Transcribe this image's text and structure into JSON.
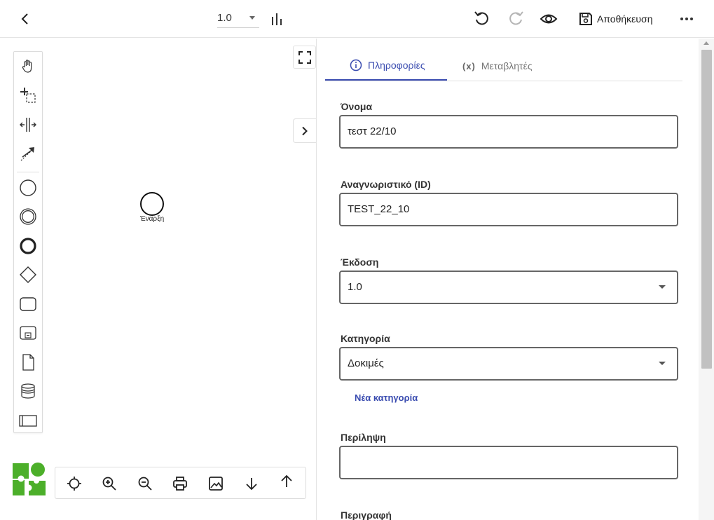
{
  "topbar": {
    "version_value": "1.0",
    "save_label": "Αποθήκευση"
  },
  "canvas": {
    "start_event_label": "Έναρξη"
  },
  "panel": {
    "tabs": [
      {
        "label": "Πληροφορίες",
        "active": true
      },
      {
        "label": "Μεταβλητές",
        "active": false
      }
    ],
    "vars_tab_icon": "(x)",
    "fields": {
      "name_label": "Όνομα",
      "name_value": "τεστ 22/10",
      "id_label": "Αναγνωριστικό (ID)",
      "id_value": "TEST_22_10",
      "version_label": "Έκδοση",
      "version_value": "1.0",
      "category_label": "Κατηγορία",
      "category_value": "Δοκιμές",
      "new_category_link": "Νέα κατηγορία",
      "summary_label": "Περίληψη",
      "summary_value": "",
      "description_label": "Περιγραφή"
    }
  },
  "colors": {
    "accent": "#3a4cb0",
    "logo_green": "#4caf2a"
  }
}
